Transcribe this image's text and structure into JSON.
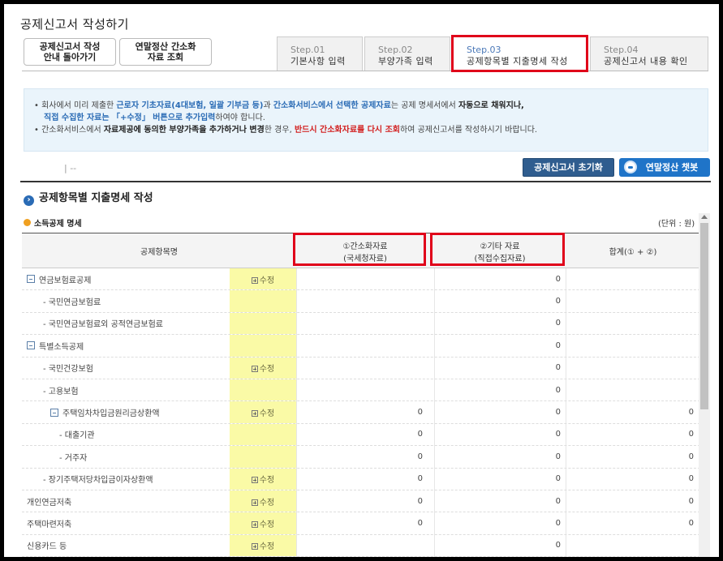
{
  "page": {
    "title": "공제신고서 작성하기"
  },
  "nav": {
    "back": [
      "공제신고서 작성",
      "안내 돌아가기"
    ],
    "simplified": [
      "연말정산 간소화",
      "자료 조회"
    ]
  },
  "steps": [
    {
      "no": "Step.01",
      "name": "기본사항 입력"
    },
    {
      "no": "Step.02",
      "name": "부양가족 입력"
    },
    {
      "no": "Step.03",
      "name": "공제항목별 지출명세 작성"
    },
    {
      "no": "Step.04",
      "name": "공제신고서 내용 확인"
    }
  ],
  "info": {
    "l1": [
      "• 회사에서 미리 제출한 ",
      "근로자 기초자료(4대보험, 일괄 기부금 등)",
      "과 ",
      "간소화서비스에서 선택한 공제자료",
      "는 공제 명세서에서 ",
      "자동으로 채워지나,"
    ],
    "l2": [
      "직접 수집한 자료는 「+수정」 버튼으로 추가입력",
      "하여야 합니다."
    ],
    "l3": [
      "• 간소화서비스에서 ",
      "자료제공에 동의한 부양가족을 추가하거나 변경",
      "한 경우, ",
      "반드시 간소화자료를 다시 조회",
      "하여 공제신고서를 작성하시기 바랍니다."
    ]
  },
  "toolbar": {
    "dash": "|   --",
    "reset": "공제신고서 초기화",
    "chatbot": "연말정산 챗봇"
  },
  "section": {
    "title": "공제항목별 지출명세 작성",
    "subtitle": "소득공제 명세",
    "unit": "(단위 : 원)"
  },
  "table": {
    "headers": {
      "name": "공제항목명",
      "a": [
        "①간소화자료",
        "(국세청자료)"
      ],
      "b": [
        "②기타 자료",
        "(직접수집자료)"
      ],
      "sum": "합계(① + ②)"
    },
    "edit_label": "수정",
    "rows": [
      {
        "name": "연금보험료공제",
        "edit": true,
        "a": "",
        "b": "0",
        "sum": ""
      },
      {
        "name": "- 국민연금보험료",
        "edit": false,
        "a": "",
        "b": "0",
        "sum": ""
      },
      {
        "name": "- 국민연금보험료외 공적연금보험료",
        "edit": false,
        "a": "",
        "b": "0",
        "sum": ""
      },
      {
        "name": "특별소득공제",
        "edit": false,
        "a": "",
        "b": "0",
        "sum": ""
      },
      {
        "name": "- 국민건강보험",
        "edit": true,
        "a": "",
        "b": "0",
        "sum": ""
      },
      {
        "name": "- 고용보험",
        "edit": false,
        "a": "",
        "b": "0",
        "sum": ""
      },
      {
        "name": "주택임차차입금원리금상환액",
        "edit": true,
        "a": "0",
        "b": "0",
        "sum": "0"
      },
      {
        "name": "- 대출기관",
        "edit": false,
        "a": "0",
        "b": "0",
        "sum": "0"
      },
      {
        "name": "- 거주자",
        "edit": false,
        "a": "0",
        "b": "0",
        "sum": "0"
      },
      {
        "name": "- 장기주택저당차입금이자상환액",
        "edit": true,
        "a": "0",
        "b": "0",
        "sum": "0"
      },
      {
        "name": "개인연금저축",
        "edit": true,
        "a": "0",
        "b": "0",
        "sum": "0"
      },
      {
        "name": "주택마련저축",
        "edit": true,
        "a": "0",
        "b": "0",
        "sum": "0"
      },
      {
        "name": "신용카드 등",
        "edit": true,
        "a": "",
        "b": "0",
        "sum": ""
      }
    ]
  }
}
